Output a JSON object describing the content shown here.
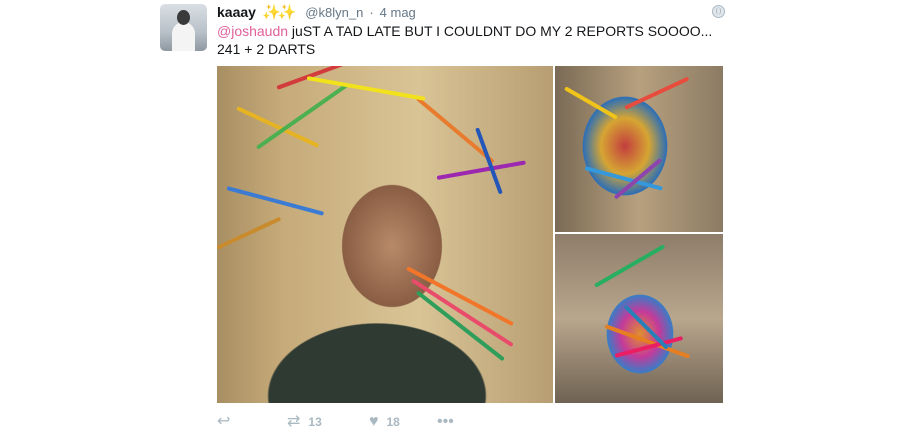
{
  "tweet": {
    "author_name": "kaaay",
    "author_emoji": "✨✨",
    "handle": "@k8lyn_n",
    "separator": "·",
    "time": "4 mag",
    "mention": "@joshaudn",
    "body_line1": " juST A TAD LATE BUT I COULDNT DO MY 2 REPORTS SOOOO...",
    "body_line2": "241 + 2 DARTS"
  },
  "actions": {
    "reply_icon": "reply-icon",
    "retweet_icon": "retweet-icon",
    "retweet_count": "13",
    "like_icon": "heart-icon",
    "like_count": "18",
    "more_icon": "more-icon"
  },
  "colors": {
    "mention": "#e0609b",
    "meta": "#657786",
    "action_gray": "#aab8c2"
  }
}
